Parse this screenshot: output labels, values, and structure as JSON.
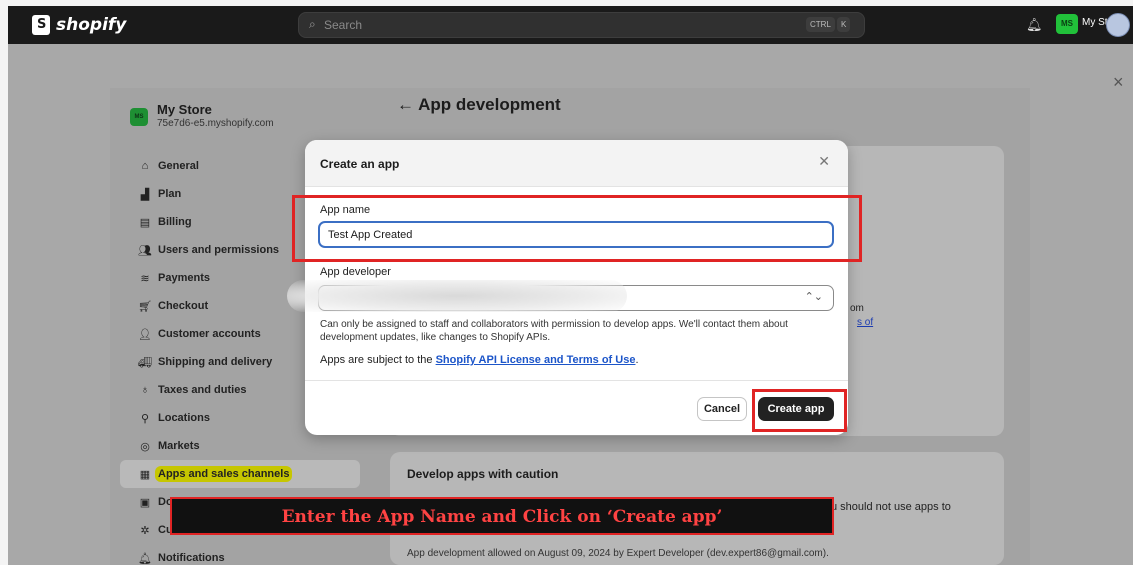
{
  "topbar": {
    "logo_text": "shopify",
    "search_placeholder": "Search",
    "shortcut_ctrl": "CTRL",
    "shortcut_k": "K",
    "avatar_initials": "MS",
    "store_name": "My Store"
  },
  "sidebar": {
    "store_name": "My Store",
    "store_domain": "75e7d6-e5.myshopify.com",
    "avatar_initials": "MS",
    "items": [
      {
        "label": "General",
        "icon": "store-icon"
      },
      {
        "label": "Plan",
        "icon": "chart-icon"
      },
      {
        "label": "Billing",
        "icon": "billing-icon"
      },
      {
        "label": "Users and permissions",
        "icon": "users-icon"
      },
      {
        "label": "Payments",
        "icon": "payments-icon"
      },
      {
        "label": "Checkout",
        "icon": "cart-icon"
      },
      {
        "label": "Customer accounts",
        "icon": "person-icon"
      },
      {
        "label": "Shipping and delivery",
        "icon": "truck-icon"
      },
      {
        "label": "Taxes and duties",
        "icon": "taxes-icon"
      },
      {
        "label": "Locations",
        "icon": "location-icon"
      },
      {
        "label": "Markets",
        "icon": "globe-icon"
      },
      {
        "label": "Apps and sales channels",
        "icon": "apps-icon",
        "active": true
      },
      {
        "label": "Do",
        "icon": "domains-icon"
      },
      {
        "label": "Cu",
        "icon": "customer-events-icon"
      },
      {
        "label": "Notifications",
        "icon": "bell-icon"
      }
    ]
  },
  "main": {
    "page_title": "App development",
    "back_arrow": "←",
    "peek_text_1": "om",
    "peek_text_2": "s of",
    "caution_title": "Develop apps with caution",
    "caution_fragment": "u should not use apps to",
    "caution_note": "App development allowed on August 09, 2024 by Expert Developer (dev.expert86@gmail.com)."
  },
  "modal": {
    "title": "Create an app",
    "app_name_label": "App name",
    "app_name_value": "Test App Created",
    "app_developer_label": "App developer",
    "help_text": "Can only be assigned to staff and collaborators with permission to develop apps. We'll contact them about development updates, like changes to Shopify APIs.",
    "terms_prefix": "Apps are subject to the",
    "terms_link": "Shopify API License and Terms of Use",
    "terms_suffix": ".",
    "cancel_label": "Cancel",
    "create_label": "Create app"
  },
  "caption": "Enter the App Name and Click on ‘Create app’",
  "colors": {
    "highlight": "#e02424",
    "caption_text": "#ff4343",
    "active_highlight": "#c6c600",
    "brand_green": "#21c13a"
  }
}
